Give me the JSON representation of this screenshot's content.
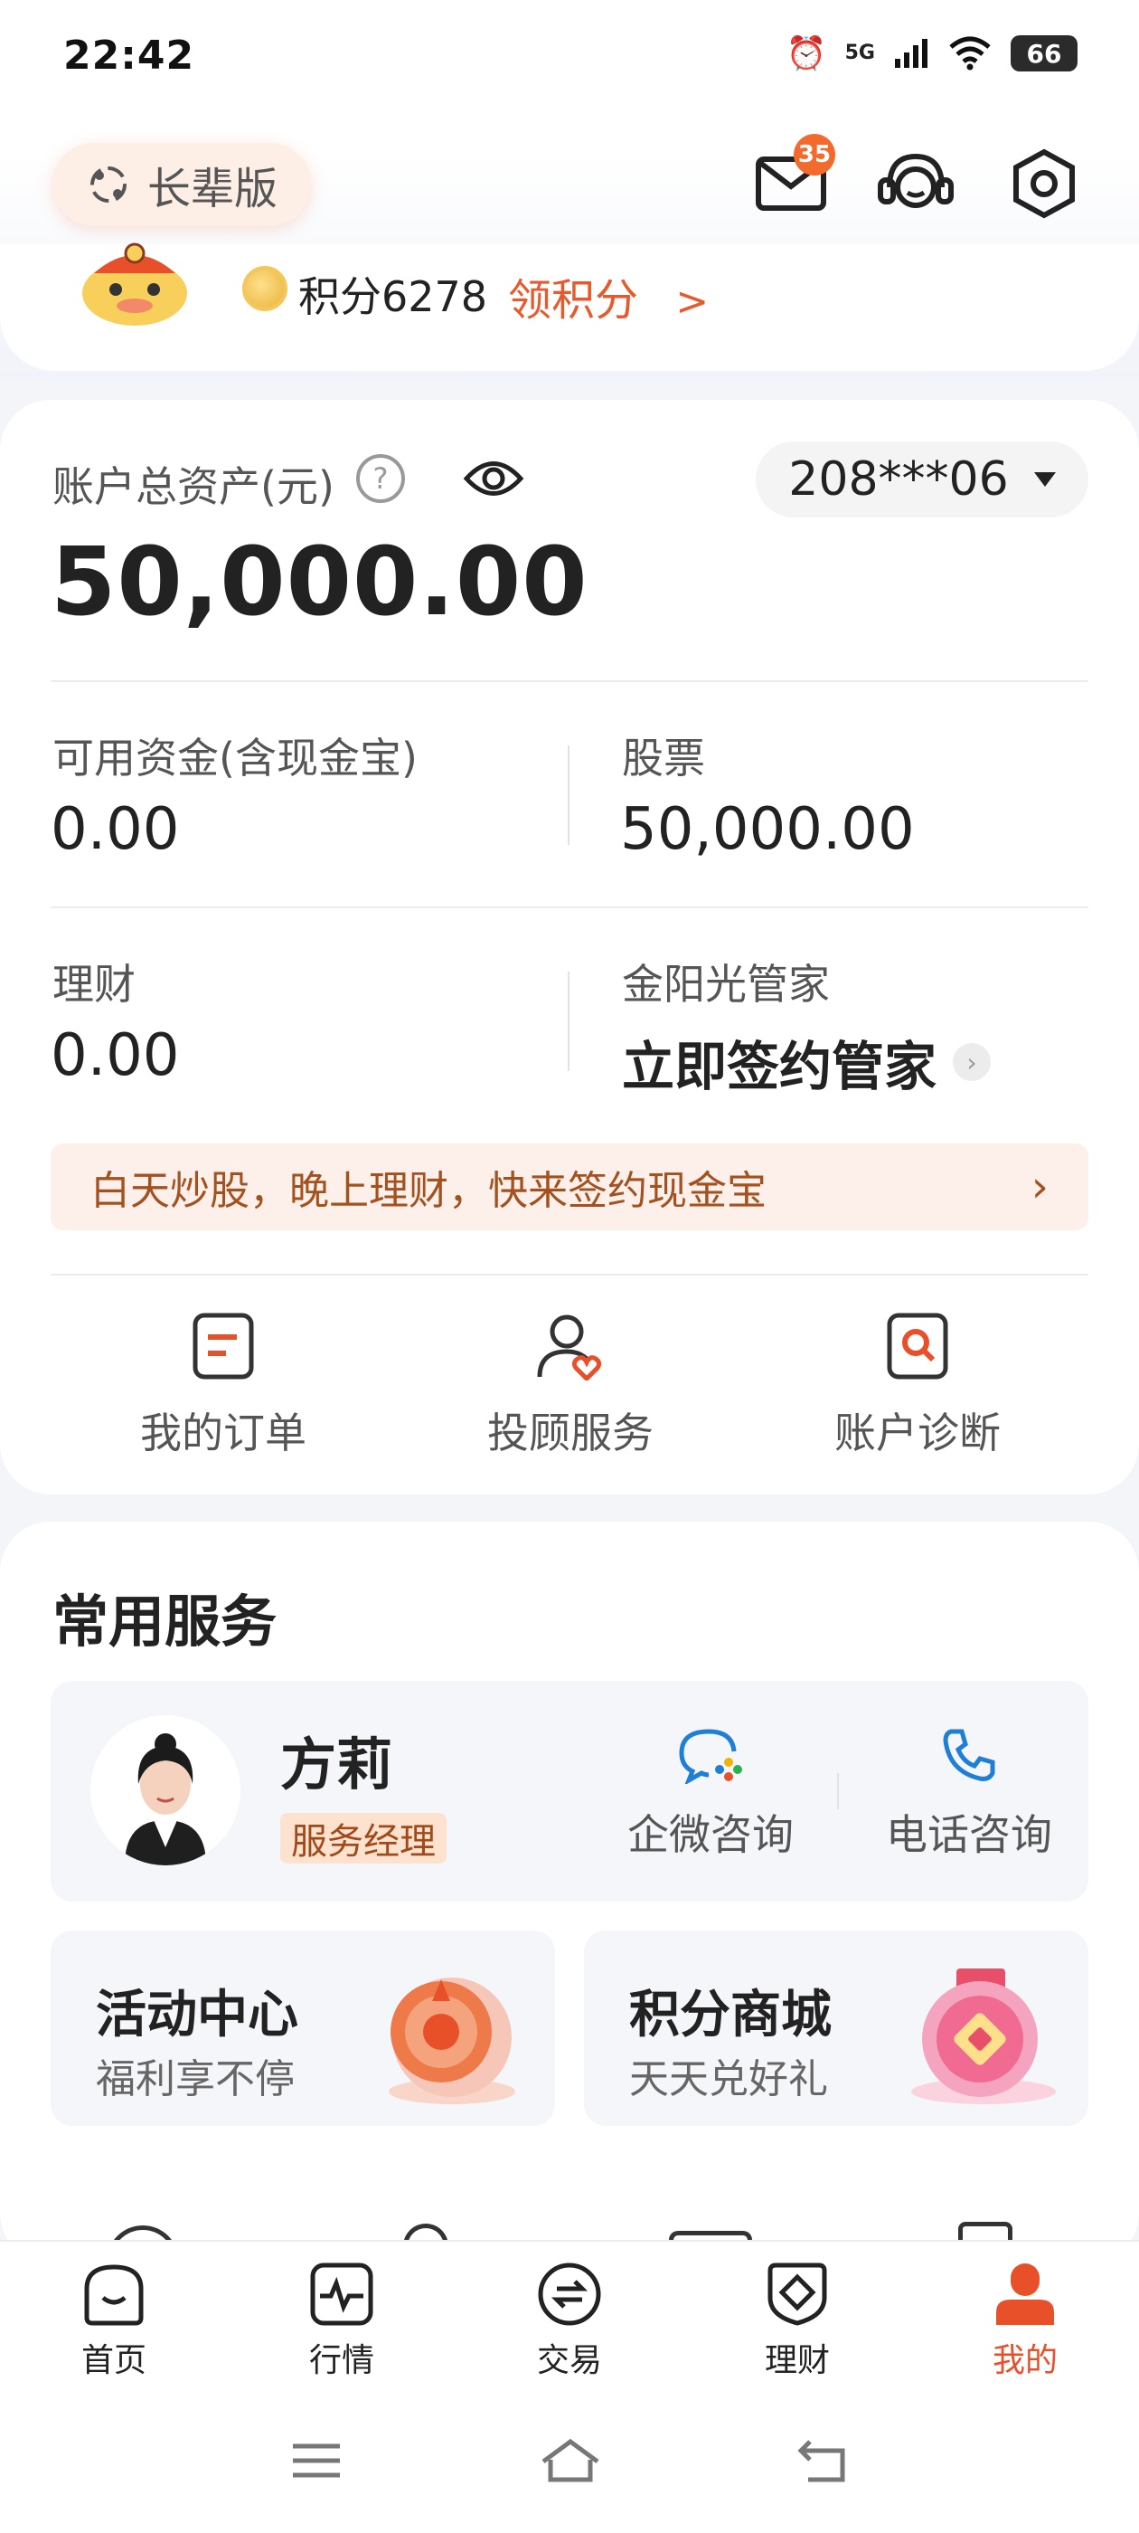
{
  "status_bar": {
    "time": "22:42",
    "network": "5G",
    "battery": "66"
  },
  "header": {
    "elder_mode_label": "长辈版",
    "mail_badge_count": "35"
  },
  "points": {
    "label": "积分6278",
    "link_label": "领积分",
    "link_arrow": ">"
  },
  "asset": {
    "total_label": "账户总资产(元)",
    "total_value": "50,000.00",
    "account_number": "208***06",
    "available_label": "可用资金(含现金宝)",
    "available_value": "0.00",
    "stock_label": "股票",
    "stock_value": "50,000.00",
    "wealth_label": "理财",
    "wealth_value": "0.00",
    "butler_label": "金阳光管家",
    "butler_action": "立即签约管家",
    "promo_text": "白天炒股，晚上理财，快来签约现金宝",
    "quick_actions": [
      {
        "label": "我的订单",
        "icon": "order-icon"
      },
      {
        "label": "投顾服务",
        "icon": "advisor-icon"
      },
      {
        "label": "账户诊断",
        "icon": "diagnosis-icon"
      }
    ]
  },
  "services": {
    "title": "常用服务",
    "manager_name": "方莉",
    "manager_role": "服务经理",
    "wecom_label": "企微咨询",
    "phone_label": "电话咨询",
    "tiles": [
      {
        "title": "活动中心",
        "subtitle": "福利享不停",
        "icon": "activity-icon"
      },
      {
        "title": "积分商城",
        "subtitle": "天天兑好礼",
        "icon": "points-mall-icon"
      }
    ]
  },
  "bottom_nav": [
    {
      "label": "首页",
      "icon": "home-icon",
      "active": false
    },
    {
      "label": "行情",
      "icon": "market-icon",
      "active": false
    },
    {
      "label": "交易",
      "icon": "trade-icon",
      "active": false
    },
    {
      "label": "理财",
      "icon": "wealth-icon",
      "active": false
    },
    {
      "label": "我的",
      "icon": "profile-icon",
      "active": true
    }
  ],
  "colors": {
    "accent": "#e8502a",
    "promo_text": "#a3511f",
    "link": "#1f7ed6"
  }
}
